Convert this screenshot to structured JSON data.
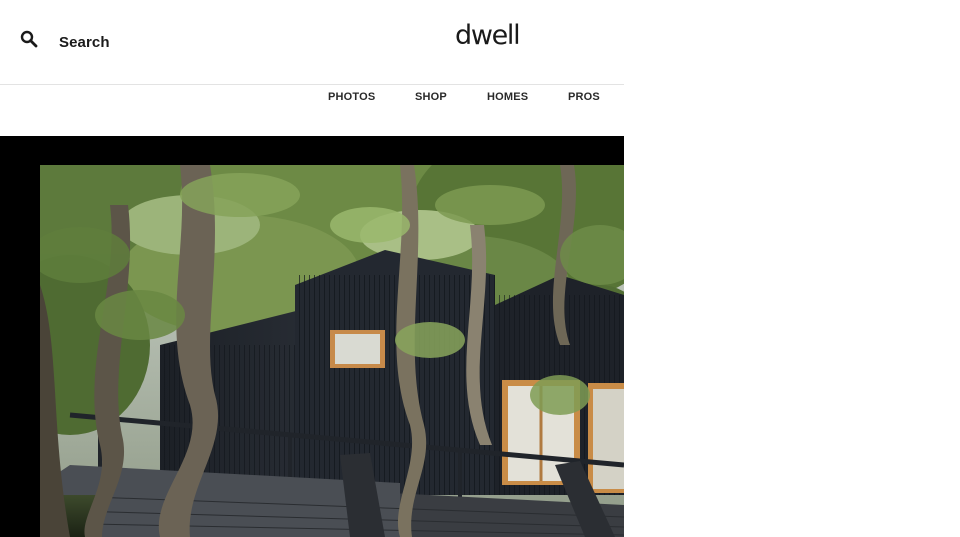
{
  "header": {
    "search_label": "Search",
    "search_icon": "search-icon",
    "logo_text": "dwell"
  },
  "nav": {
    "items": [
      {
        "label": "PHOTOS"
      },
      {
        "label": "SHOP"
      },
      {
        "label": "HOMES"
      },
      {
        "label": "PROS"
      }
    ]
  },
  "hero": {
    "image": "photo-black-timber-cabin-in-forest"
  },
  "colors": {
    "background": "#ffffff",
    "text": "#1a1a1a",
    "hero_frame": "#000000",
    "divider": "#e3e3e3"
  }
}
